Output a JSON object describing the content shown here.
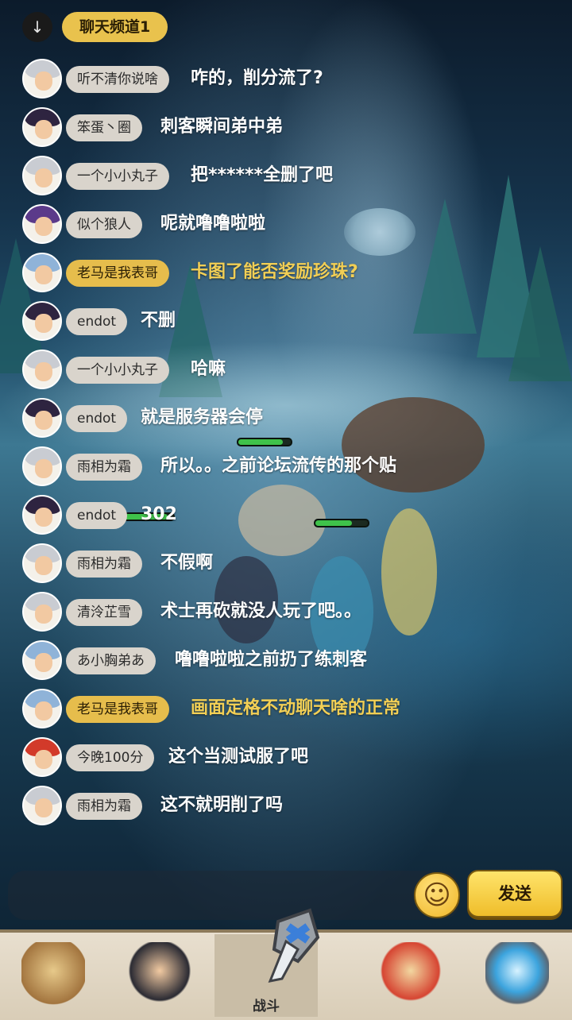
{
  "top": {
    "scroll_icon": "↓",
    "channel": "聊天频道1"
  },
  "messages": [
    {
      "name": "听不清你说啥",
      "text": "咋的，削分流了?",
      "vip": false,
      "hair": "#c9ccd2"
    },
    {
      "name": "笨蛋丶圈",
      "text": "刺客瞬间弟中弟",
      "vip": false,
      "hair": "#2e2440"
    },
    {
      "name": "一个小小丸子",
      "text": "把******全删了吧",
      "vip": false,
      "hair": "#c9ccd2"
    },
    {
      "name": "似个狼人",
      "text": "呢就噜噜啦啦",
      "vip": false,
      "hair": "#5b3a8a"
    },
    {
      "name": "老马是我表哥",
      "text": "卡图了能否奖励珍珠?",
      "vip": true,
      "hair": "#8fb3d8"
    },
    {
      "name": "endot",
      "text": "不删",
      "vip": false,
      "hair": "#2e2440"
    },
    {
      "name": "一个小小丸子",
      "text": "哈嘛",
      "vip": false,
      "hair": "#c9ccd2"
    },
    {
      "name": "endot",
      "text": "就是服务器会停",
      "vip": false,
      "hair": "#2e2440"
    },
    {
      "name": "雨相为霜",
      "text": "所以。。之前论坛流传的那个贴",
      "vip": false,
      "hair": "#c9ccd2"
    },
    {
      "name": "endot",
      "text": "302",
      "vip": false,
      "hair": "#2e2440"
    },
    {
      "name": "雨相为霜",
      "text": "不假啊",
      "vip": false,
      "hair": "#c9ccd2"
    },
    {
      "name": "清泠芷雪",
      "text": "术士再砍就没人玩了吧。。",
      "vip": false,
      "hair": "#c9ccd2"
    },
    {
      "name": "あ小胸弟あ",
      "text": "噜噜啦啦之前扔了练刺客",
      "vip": false,
      "hair": "#8fb3d8"
    },
    {
      "name": "老马是我表哥",
      "text": "画面定格不动聊天啥的正常",
      "vip": true,
      "hair": "#8fb3d8"
    },
    {
      "name": "今晚100分",
      "text": "这个当测试服了吧",
      "vip": false,
      "hair": "#d23a2a"
    },
    {
      "name": "雨相为霜",
      "text": "这不就明削了吗",
      "vip": false,
      "hair": "#c9ccd2"
    }
  ],
  "input": {
    "emoji_icon": "☺",
    "send_label": "发送"
  },
  "nav": {
    "items": [
      {
        "icon": "beast-hero-icon",
        "label": ""
      },
      {
        "icon": "warrior-hero-icon",
        "label": ""
      },
      {
        "icon": "battle-sword-icon",
        "label": "战斗"
      },
      {
        "icon": "dragon-pet-icon",
        "label": ""
      },
      {
        "icon": "portal-shrine-icon",
        "label": ""
      }
    ]
  }
}
